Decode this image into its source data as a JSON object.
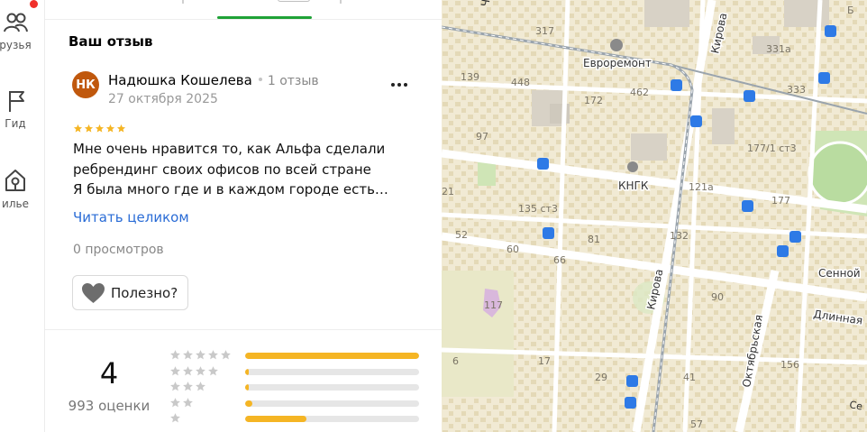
{
  "sidebar": {
    "items": [
      {
        "label": "рузья",
        "icon": "friends-icon"
      },
      {
        "label": "Гид",
        "icon": "guide-flag-icon"
      },
      {
        "label": "илье",
        "icon": "housing-icon"
      }
    ],
    "notification_color": "#f0302a"
  },
  "review": {
    "section_title": "Ваш отзыв",
    "avatar_initials": "НК",
    "avatar_color": "#c0580d",
    "author_name": "Надюшка Кошелева",
    "author_reviews": "1 отзыв",
    "date": "27 октября 2025",
    "rating": 5,
    "text_lines": [
      "Мне очень нравится то, как Альфа сделали",
      "ребрендинг своих офисов по всей стране",
      "Я была много где и в каждом городе есть…"
    ],
    "read_more": "Читать целиком",
    "views": "0 просмотров",
    "useful_label": "Полезно?"
  },
  "summary": {
    "average": "4",
    "count_label": "993 оценки",
    "distribution": [
      {
        "stars": 5,
        "fraction": 1.0
      },
      {
        "stars": 4,
        "fraction": 0.02
      },
      {
        "stars": 3,
        "fraction": 0.02
      },
      {
        "stars": 2,
        "fraction": 0.04
      },
      {
        "stars": 1,
        "fraction": 0.35
      }
    ],
    "bar_color": "#f5b524",
    "star_color": "#f5b524"
  },
  "map": {
    "streets": [
      "Кирова",
      "Кирова",
      "Октябрьская",
      "Длинная"
    ],
    "places": [
      "Евроремонт",
      "КНГК",
      "Сенной"
    ],
    "numbers": [
      "317",
      "331а",
      "333",
      "139",
      "448",
      "462",
      "172",
      "97",
      "177/1 ст3",
      "121а",
      "177",
      "135 ст3",
      "52",
      "60",
      "81",
      "132",
      "66",
      "90",
      "117",
      "156",
      "17",
      "6",
      "29",
      "41",
      "21",
      "57"
    ],
    "fragments": [
      "Ч",
      "Б",
      "Се"
    ]
  }
}
